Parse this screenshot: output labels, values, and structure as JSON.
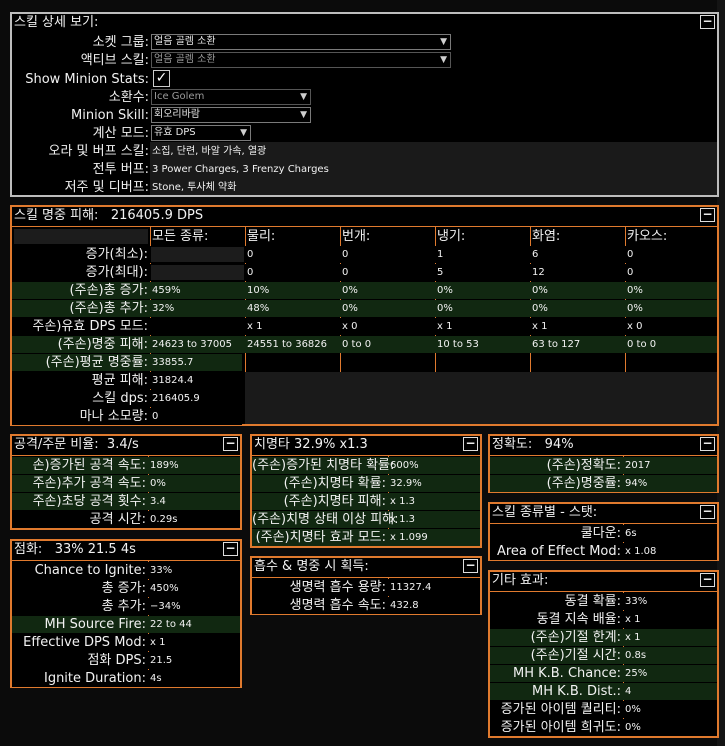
{
  "details": {
    "title": "스킬 상세 보기:",
    "rows": {
      "socket_group": {
        "label": "소켓 그룹:",
        "value": "얼음 골렘 소환"
      },
      "active_skill": {
        "label": "액티브 스킬:",
        "value": "얼음 골렘 소환"
      },
      "show_minion": {
        "label": "Show Minion Stats:",
        "checked": true,
        "check_glyph": "✓"
      },
      "minion": {
        "label": "소환수:",
        "value": "Ice Golem"
      },
      "minion_skill": {
        "label": "Minion Skill:",
        "value": "회오리바람"
      },
      "calc_mode": {
        "label": "계산 모드:",
        "value": "유효 DPS"
      },
      "aura_buff": {
        "label": "오라 및 버프 스킬:",
        "value": "소집, 단련, 바알 가속, 열광"
      },
      "combat_buff": {
        "label": "전투 버프:",
        "value": "3 Power Charges, 3 Frenzy Charges"
      },
      "curse": {
        "label": "저주 및 디버프:",
        "value": "Stone, 투사체 약화"
      }
    }
  },
  "hit": {
    "title": "스킬 명중 피해:",
    "dps": "216405.9 DPS",
    "columns": [
      "모든 종류:",
      "물리:",
      "번개:",
      "냉기:",
      "화염:",
      "카오스:"
    ],
    "rows": [
      {
        "label": "증가(최소):",
        "cells": [
          "",
          "0",
          "0",
          "1",
          "6",
          "0"
        ],
        "bg": "dark"
      },
      {
        "label": "증가(최대):",
        "cells": [
          "",
          "0",
          "0",
          "5",
          "12",
          "0"
        ],
        "bg": "dark"
      },
      {
        "label": "(주손)총 증가:",
        "cells": [
          "459%",
          "10%",
          "0%",
          "0%",
          "0%",
          "0%"
        ],
        "bg": "green"
      },
      {
        "label": "(주손)총 추가:",
        "cells": [
          "32%",
          "48%",
          "0%",
          "0%",
          "0%",
          "0%"
        ],
        "bg": "green"
      },
      {
        "label": "주손)유효 DPS 모드:",
        "cells": [
          "",
          "x 1",
          "x 0",
          "x 1",
          "x 1",
          "x 0"
        ],
        "bg": "dark"
      },
      {
        "label": "(주손)명중 피해:",
        "cells": [
          "24623 to 37005",
          "24551 to 36826",
          "0 to 0",
          "10 to 53",
          "63 to 127",
          "0 to 0"
        ],
        "bg": "green"
      },
      {
        "label": "(주손)평균 명중률:",
        "cells": [
          "33855.7"
        ],
        "bg": "green"
      },
      {
        "label": "평균 피해:",
        "cells": [
          "31824.4"
        ],
        "bg": "dark"
      },
      {
        "label": "스킬 dps:",
        "cells": [
          "216405.9"
        ],
        "bg": "dark"
      },
      {
        "label": "마나 소모량:",
        "cells": [
          "0"
        ],
        "bg": "dark"
      }
    ]
  },
  "attack": {
    "title": "공격/주문 비율:",
    "value": "3.4/s",
    "rows": [
      {
        "label": "손)증가된 공격 속도:",
        "value": "189%"
      },
      {
        "label": "주손)추가 공격 속도:",
        "value": "0%"
      },
      {
        "label": "주손)초당 공격 횟수:",
        "value": "3.4"
      },
      {
        "label": "공격 시간:",
        "value": "0.29s"
      }
    ]
  },
  "crit": {
    "title": "치명타",
    "value": "32.9% x1.3",
    "rows": [
      {
        "label": "(주손)증가된 치명타 확률:",
        "value": "600%"
      },
      {
        "label": "(주손)치명타 확률:",
        "value": "32.9%"
      },
      {
        "label": "(주손)치명타 피해:",
        "value": "x 1.3"
      },
      {
        "label": "(주손)치명 상태 이상 피해:",
        "value": "x 1.3"
      },
      {
        "label": "(주손)치명타 효과 모드:",
        "value": "x 1.099"
      }
    ]
  },
  "accuracy": {
    "title": "정확도:",
    "value": "94%",
    "rows": [
      {
        "label": "(주손)정확도:",
        "value": "2017"
      },
      {
        "label": "(주손)명중률:",
        "value": "94%"
      }
    ]
  },
  "ignite": {
    "title": "점화:",
    "value": "33% 21.5 4s",
    "rows": [
      {
        "label": "Chance to Ignite:",
        "value": "33%"
      },
      {
        "label": "총 증가:",
        "value": "450%"
      },
      {
        "label": "총 추가:",
        "value": "−34%"
      },
      {
        "label": "MH Source Fire:",
        "value": "22 to 44"
      },
      {
        "label": "Effective DPS Mod:",
        "value": "x 1"
      },
      {
        "label": "점화 DPS:",
        "value": "21.5"
      },
      {
        "label": "Ignite Duration:",
        "value": "4s"
      }
    ]
  },
  "leech": {
    "title": "흡수 & 명중 시 획득:",
    "rows": [
      {
        "label": "생명력 흡수 용량:",
        "value": "11327.4"
      },
      {
        "label": "생명력 흡수 속도:",
        "value": "432.8"
      }
    ]
  },
  "skilltype": {
    "title": "스킬 종류별 - 스탯:",
    "rows": [
      {
        "label": "쿨다운:",
        "value": "6s"
      },
      {
        "label": "Area of Effect Mod:",
        "value": "x 1.08"
      }
    ]
  },
  "other": {
    "title": "기타 효과:",
    "rows": [
      {
        "label": "동결 확률:",
        "value": "33%"
      },
      {
        "label": "동결 지속 배율:",
        "value": "x 1"
      },
      {
        "label": "(주손)기절 한계:",
        "value": "x 1"
      },
      {
        "label": "(주손)기절 시간:",
        "value": "0.8s"
      },
      {
        "label": "MH K.B. Chance:",
        "value": "25%"
      },
      {
        "label": "MH K.B. Dist.:",
        "value": "4"
      },
      {
        "label": "증가된 아이템 퀄리티:",
        "value": "0%"
      },
      {
        "label": "증가된 아이템 희귀도:",
        "value": "0%"
      }
    ]
  },
  "ui": {
    "collapse_glyph": "−",
    "dropdown_glyph": "▼"
  }
}
